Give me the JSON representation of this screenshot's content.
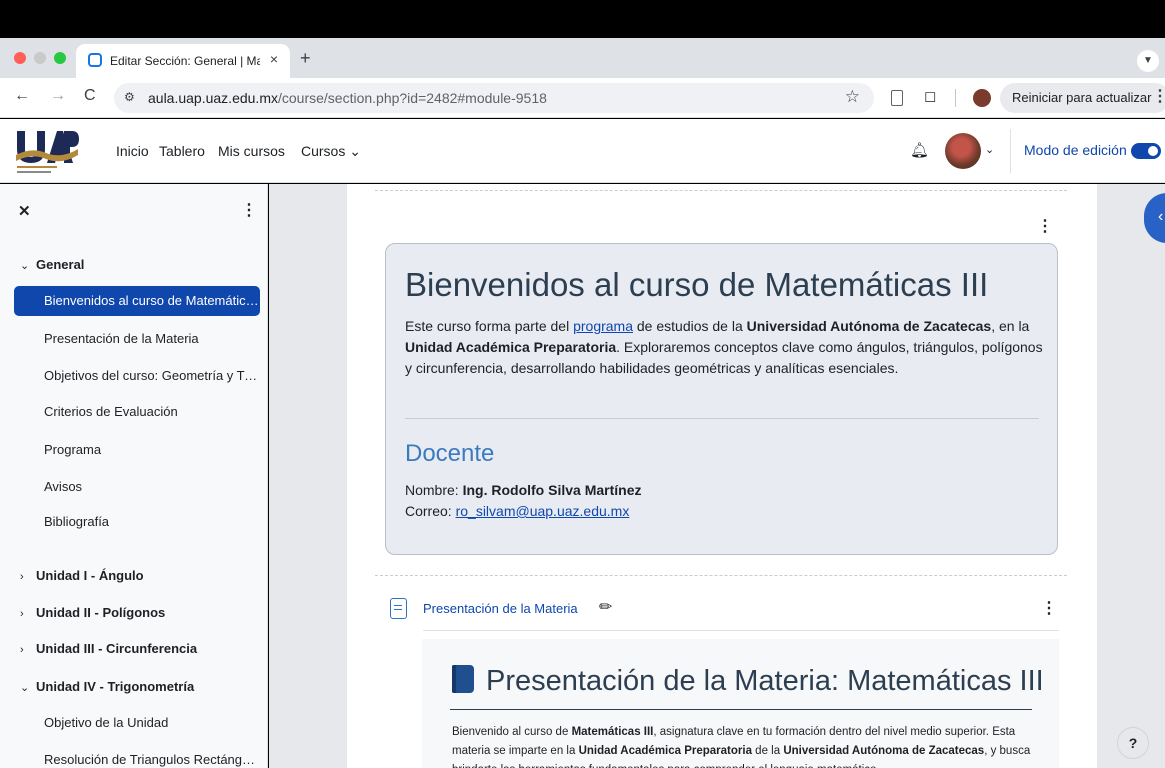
{
  "browser": {
    "tab_title": "Editar Sección: General | Matemáticas III",
    "tab_close": "×",
    "new_tab": "+",
    "tab_menu_icon": "chevron-down-icon",
    "url_host": "aula.uap.uaz.edu.mx",
    "url_path": "/course/section.php?id=2482#module-9518",
    "relaunch_label": "Reiniciar para actualizar",
    "nav": {
      "back": "←",
      "forward": "→",
      "reload": "C"
    }
  },
  "navbar": {
    "links": [
      "Inicio",
      "Tablero",
      "Mis cursos",
      "Cursos ⌄"
    ],
    "edit_mode_label": "Modo de edición",
    "edit_mode_on": true
  },
  "course_index": {
    "sections": [
      {
        "label": "General",
        "expanded": true
      },
      {
        "label": "Unidad I - Ángulo",
        "expanded": false
      },
      {
        "label": "Unidad II - Polígonos",
        "expanded": false
      },
      {
        "label": "Unidad III - Circunferencia",
        "expanded": false
      },
      {
        "label": "Unidad IV - Trigonometría",
        "expanded": true
      }
    ],
    "general_items": [
      "Bienvenidos al curso de Matemáticas III",
      "Presentación de la Materia",
      "Objetivos del curso: Geometría y Trigonometría",
      "Criterios de Evaluación",
      "Programa",
      "Avisos",
      "Bibliografía"
    ],
    "unit4_items": [
      "Objetivo de la Unidad",
      "Resolución de Triangulos Rectángulos"
    ],
    "active_item": "Bienvenidos al curso de Matemáticas III"
  },
  "welcome": {
    "title": "Bienvenidos al curso de Matemáticas III",
    "p_before_link": "Este curso forma parte del ",
    "link": "programa",
    "p_after_link": " de estudios de la ",
    "uni": "Universidad Autónoma de Zacatecas",
    "p_mid": ", en la ",
    "unidad": "Unidad Académica Preparatoria",
    "p_end": ". Exploraremos conceptos clave como ángulos, triángulos, polígonos y circunferencia, desarrollando habilidades geométricas y analíticas esenciales.",
    "docente_heading": "Docente",
    "nombre_label": "Nombre: ",
    "nombre_value": "Ing. Rodolfo Silva Martínez",
    "correo_label": "Correo: ",
    "correo_value": "ro_silvam@uap.uaz.edu.mx"
  },
  "activity": {
    "title": "Presentación de la Materia"
  },
  "presentation": {
    "title": "Presentación de la Materia: Matemáticas III",
    "b1": "Bienvenido al curso de ",
    "b1_strong": "Matemáticas III",
    "b2": ", asignatura clave en tu formación dentro del nivel medio superior. Esta materia se imparte en la ",
    "b2_strong": "Unidad Académica Preparatoria",
    "b3": " de la ",
    "b3_strong": "Universidad Autónoma de Zacatecas",
    "b4": ", y busca brindarte las herramientas fundamentales para comprender el lenguaje matemático."
  },
  "help_label": "?",
  "colors": {
    "primary": "#0f47ad",
    "heading": "#2c3e50",
    "docente": "#3a7bbf"
  }
}
